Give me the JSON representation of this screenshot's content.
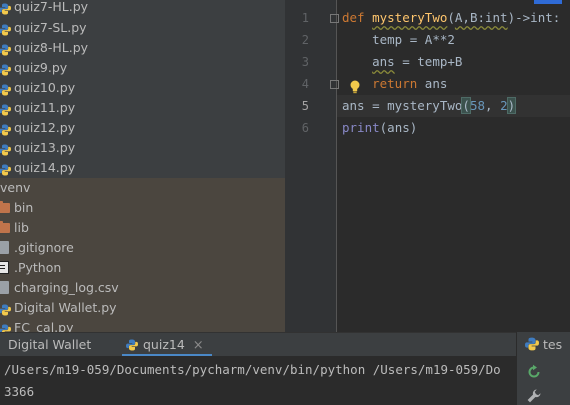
{
  "project_tree": {
    "files_top": [
      {
        "name": "quiz7-HL.py",
        "type": "python"
      },
      {
        "name": "quiz7-SL.py",
        "type": "python"
      },
      {
        "name": "quiz8-HL.py",
        "type": "python"
      },
      {
        "name": "quiz9.py",
        "type": "python"
      },
      {
        "name": "quiz10.py",
        "type": "python"
      },
      {
        "name": "quiz11.py",
        "type": "python"
      },
      {
        "name": "quiz12.py",
        "type": "python"
      },
      {
        "name": "quiz13.py",
        "type": "python"
      },
      {
        "name": "quiz14.py",
        "type": "python"
      }
    ],
    "venv_label": "venv",
    "venv_items": [
      {
        "name": "bin",
        "type": "folder"
      },
      {
        "name": "lib",
        "type": "folder"
      },
      {
        "name": ".gitignore",
        "type": "file"
      },
      {
        "name": ".Python",
        "type": "exec"
      },
      {
        "name": "charging_log.csv",
        "type": "file"
      },
      {
        "name": "Digital Wallet.py",
        "type": "python"
      },
      {
        "name": "FC_cal.py",
        "type": "python"
      }
    ]
  },
  "editor": {
    "line_numbers": [
      "1",
      "2",
      "3",
      "4",
      "5",
      "6"
    ],
    "current_line": "5",
    "code": {
      "l1_kw": "def",
      "l1_fn": "mysteryTwo",
      "l1_open": "(",
      "l1_params": "A,B:int",
      "l1_close": ")",
      "l1_rest": "->int:",
      "l2": "temp = A**2",
      "l3_var": "ans",
      "l3_rest": " = temp+B",
      "l4_kw": "return",
      "l4_rest": " ans",
      "l5_pre": "ans = mysteryTwo",
      "l5_open": "(",
      "l5_arg1": "58",
      "l5_sep": ", ",
      "l5_arg2": "2",
      "l5_close": ")",
      "l6_fn": "print",
      "l6_rest": "(ans)"
    }
  },
  "run_panel": {
    "tabs": [
      {
        "label": "Digital Wallet",
        "closable": false
      },
      {
        "label": "quiz14",
        "closable": true,
        "close_glyph": "×"
      }
    ],
    "right_tab_label": "tes",
    "console_lines": [
      "/Users/m19-059/Documents/pycharm/venv/bin/python /Users/m19-059/Do",
      "3366"
    ]
  },
  "colors": {
    "tree_bg": "#3c3f41",
    "venv_bg": "#4b463f",
    "editor_bg": "#2b2b2b",
    "keyword": "#cc7832",
    "function": "#ffc66d",
    "number": "#6897bb",
    "builtin": "#8888c6",
    "accent": "#4a88c7"
  },
  "icons": [
    "python-file-icon",
    "folder-icon",
    "file-icon",
    "exec-file-icon",
    "lightbulb-icon",
    "rerun-icon",
    "wrench-icon"
  ]
}
